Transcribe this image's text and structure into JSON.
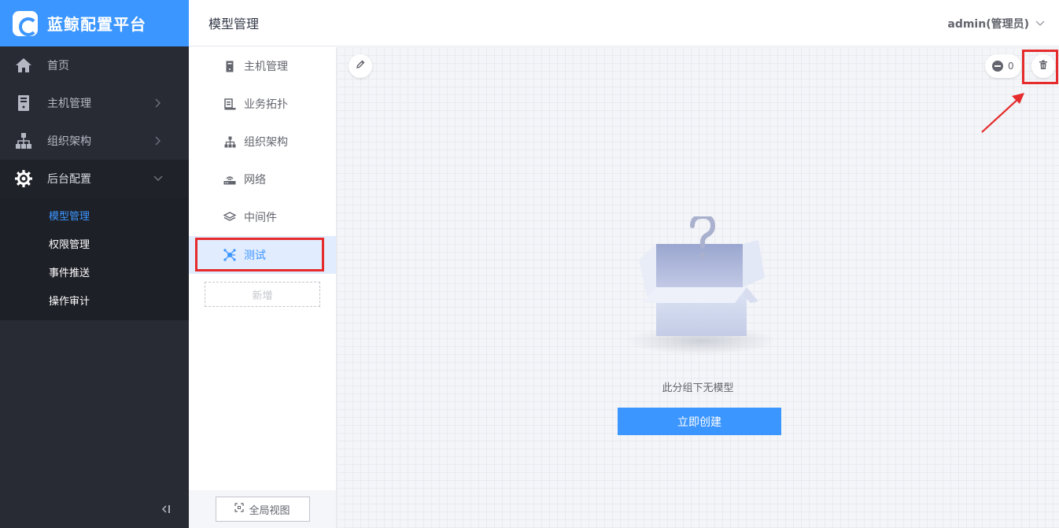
{
  "brand": {
    "title": "蓝鲸配置平台"
  },
  "nav": {
    "items": [
      {
        "label": "首页",
        "icon": "home-icon"
      },
      {
        "label": "主机管理",
        "icon": "server-icon"
      },
      {
        "label": "组织架构",
        "icon": "org-chart-icon"
      },
      {
        "label": "后台配置",
        "icon": "gear-icon"
      }
    ],
    "sub_items": [
      {
        "label": "模型管理",
        "active": true
      },
      {
        "label": "权限管理"
      },
      {
        "label": "事件推送"
      },
      {
        "label": "操作审计"
      }
    ],
    "collapse_glyph": "⟨|"
  },
  "header": {
    "title": "模型管理",
    "user": "admin(管理员)"
  },
  "groups": {
    "items": [
      {
        "label": "主机管理",
        "icon": "host-icon"
      },
      {
        "label": "业务拓扑",
        "icon": "topology-icon"
      },
      {
        "label": "组织架构",
        "icon": "org-chart-icon"
      },
      {
        "label": "网络",
        "icon": "router-icon"
      },
      {
        "label": "中间件",
        "icon": "layers-icon"
      },
      {
        "label": "测试",
        "icon": "network-node-icon",
        "active": true
      }
    ],
    "add_label": "新增",
    "global_view_label": "全局视图"
  },
  "main": {
    "hidden_count": "0",
    "empty_text": "此分组下无模型",
    "create_label": "立即创建"
  },
  "colors": {
    "accent": "#3c96ff",
    "nav_bg": "#282b33",
    "highlight": "#e52b2b"
  }
}
